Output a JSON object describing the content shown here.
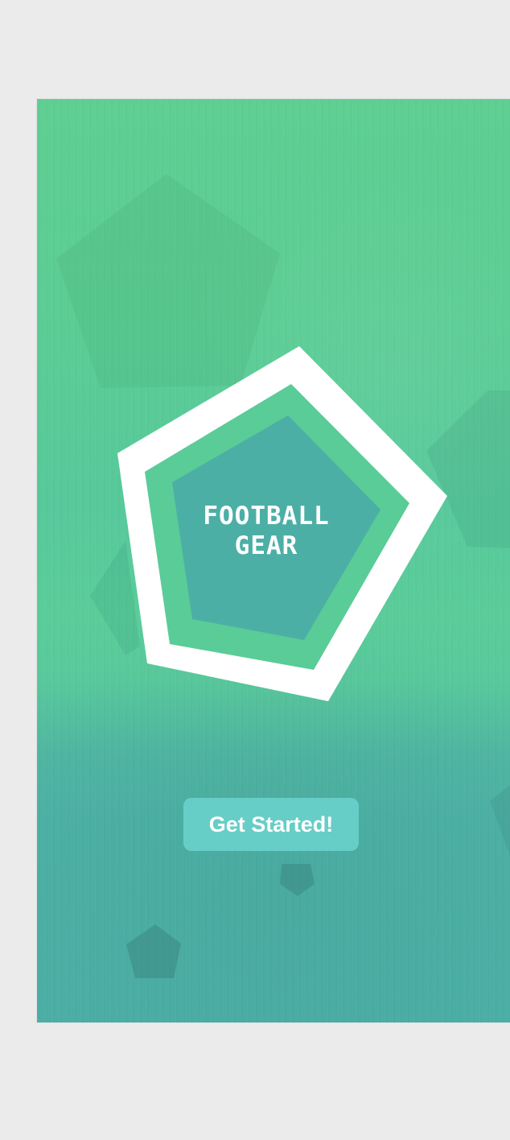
{
  "logo": {
    "line1": "FOOTBALL",
    "line2": "GEAR"
  },
  "cta": {
    "label": "Get Started!"
  },
  "colors": {
    "page_background": "#ebebeb",
    "primary_green": "#5fcf92",
    "primary_teal": "#4cafa6",
    "badge_white": "#ffffff",
    "badge_inner": "#4cafa6",
    "button_fill": "#67cdc7"
  }
}
